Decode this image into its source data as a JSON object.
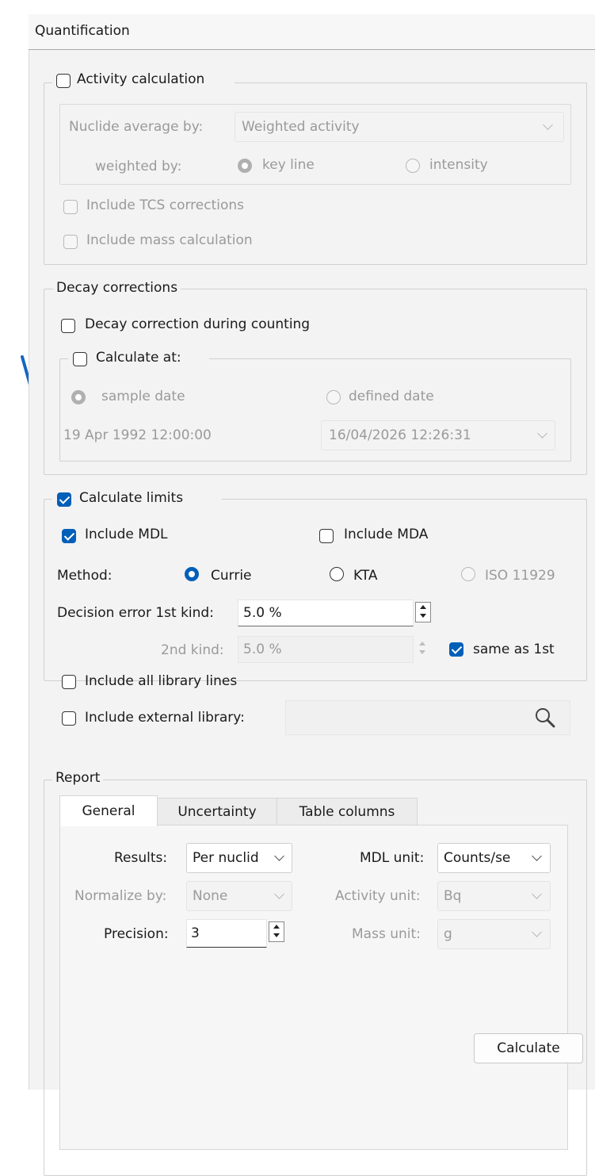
{
  "window": {
    "title": "Quantification"
  },
  "activity": {
    "title": "Activity calculation",
    "nuclide_avg_label": "Nuclide average by:",
    "nuclide_avg_value": "Weighted activity",
    "weighted_by_label": "weighted by:",
    "key_line": "key line",
    "intensity": "intensity",
    "tcs": "Include TCS corrections",
    "mass": "Include mass calculation"
  },
  "decay": {
    "title": "Decay corrections",
    "during_counting": "Decay correction during counting",
    "calculate_at": "Calculate at:",
    "sample_date": "sample date",
    "defined_date": "defined date",
    "sample_date_value": "19 Apr 1992 12:00:00",
    "defined_date_value": "16/04/2026 12:26:31"
  },
  "limits": {
    "title": "Calculate limits",
    "include_mdl": "Include MDL",
    "include_mda": "Include MDA",
    "method_label": "Method:",
    "currie": "Currie",
    "kta": "KTA",
    "iso": "ISO 11929",
    "decision_label": "Decision error 1st kind:",
    "decision_value": "5.0 %",
    "second_label": "2nd kind:",
    "second_value": "5.0 %",
    "same_as": "same as 1st",
    "all_lines": "Include all library lines",
    "external": "Include external library:"
  },
  "report": {
    "title": "Report",
    "tabs": [
      "General",
      "Uncertainty",
      "Table columns"
    ],
    "results_label": "Results:",
    "results_value": "Per nuclid",
    "mdl_unit_label": "MDL unit:",
    "mdl_unit_value": "Counts/se",
    "normalize_label": "Normalize by:",
    "normalize_value": "None",
    "activity_unit_label": "Activity unit:",
    "activity_unit_value": "Bq",
    "precision_label": "Precision:",
    "precision_value": "3",
    "mass_unit_label": "Mass unit:",
    "mass_unit_value": "g"
  },
  "calculate_button": "Calculate",
  "colors": {
    "accent": "#005fb8",
    "arrow": "#1565c0"
  }
}
